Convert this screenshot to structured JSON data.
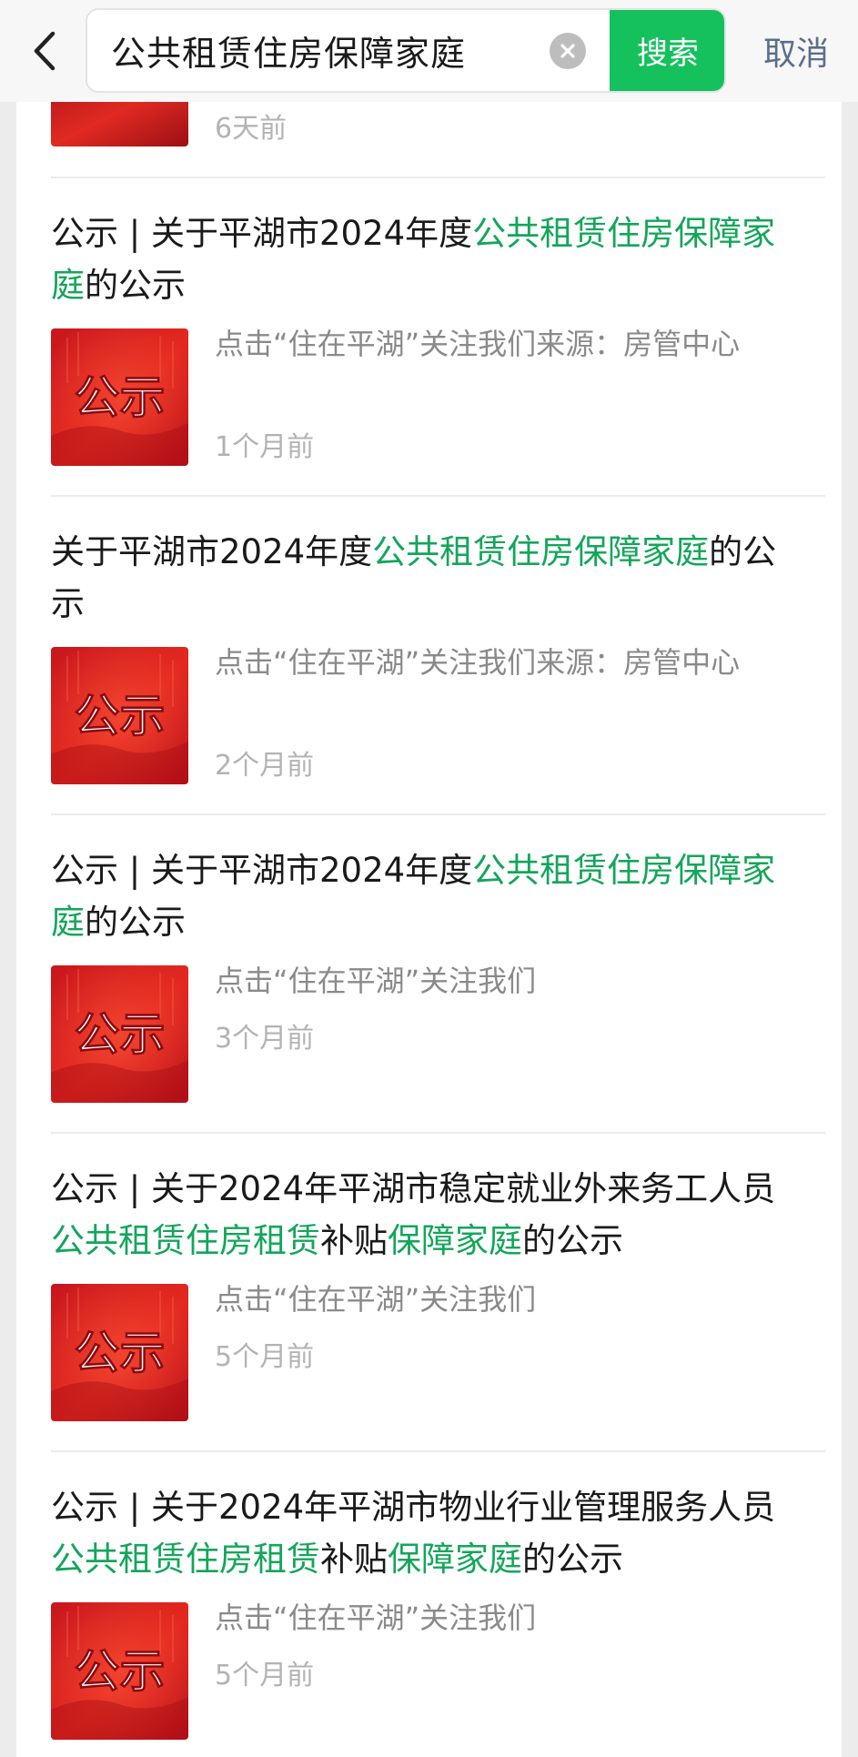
{
  "header": {
    "search_value": "公共租赁住房保障家庭",
    "search_button_label": "搜索",
    "cancel_label": "取消"
  },
  "colors": {
    "accent": "#15c15d",
    "highlight": "#13a65a",
    "thumb_red": "#e0231c"
  },
  "partial_result": {
    "time": "6天前"
  },
  "results": [
    {
      "title_parts": [
        {
          "text": "公示 | 关于平湖市2024年度",
          "hl": false
        },
        {
          "text": "公共租赁住房保障家庭",
          "hl": true
        },
        {
          "text": "的公示",
          "hl": false
        }
      ],
      "thumb_text": "公示",
      "snippet": "点击“住在平湖”关注我们来源：房管中心",
      "time": "1个月前"
    },
    {
      "title_parts": [
        {
          "text": "关于平湖市2024年度",
          "hl": false
        },
        {
          "text": "公共租赁住房保障家庭",
          "hl": true
        },
        {
          "text": "的公示",
          "hl": false
        }
      ],
      "thumb_text": "公示",
      "snippet": "点击“住在平湖”关注我们来源：房管中心",
      "time": "2个月前"
    },
    {
      "title_parts": [
        {
          "text": "公示 | 关于平湖市2024年度",
          "hl": false
        },
        {
          "text": "公共租赁住房保障家庭",
          "hl": true
        },
        {
          "text": "的公示",
          "hl": false
        }
      ],
      "thumb_text": "公示",
      "snippet": "点击“住在平湖”关注我们",
      "time": "3个月前"
    },
    {
      "title_parts": [
        {
          "text": "公示 | 关于2024年平湖市稳定就业外来务工人员",
          "hl": false
        },
        {
          "text": "公共租赁住房租赁",
          "hl": true
        },
        {
          "text": "补贴",
          "hl": false
        },
        {
          "text": "保障家庭",
          "hl": true
        },
        {
          "text": "的公示",
          "hl": false
        }
      ],
      "thumb_text": "公示",
      "snippet": "点击“住在平湖”关注我们",
      "time": "5个月前"
    },
    {
      "title_parts": [
        {
          "text": "公示 | 关于2024年平湖市物业行业管理服务人员",
          "hl": false
        },
        {
          "text": "公共租赁住房租赁",
          "hl": true
        },
        {
          "text": "补贴",
          "hl": false
        },
        {
          "text": "保障家庭",
          "hl": true
        },
        {
          "text": "的公示",
          "hl": false
        }
      ],
      "thumb_text": "公示",
      "snippet": "点击“住在平湖”关注我们",
      "time": "5个月前"
    }
  ]
}
